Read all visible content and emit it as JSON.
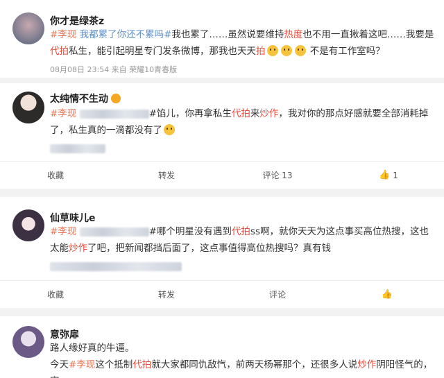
{
  "posts": [
    {
      "username": "你才是绿茶z",
      "text": {
        "tag1": "#李现",
        "tag2": " 我都累了你还不累吗#",
        "p1": "我也累了……虽然说要维持",
        "h1": "热度",
        "p2": "也不用一直揪着这吧……我要是",
        "h2": "代拍",
        "p3": "私生，能引起明星专门发条微博，那我也天天",
        "h3": "拍",
        "p4": " 不是有工作室吗？"
      },
      "meta": "08月08日 23:54  来自 荣耀10青春版"
    },
    {
      "username": "太纯情不生动",
      "text": {
        "tag1": "#李现",
        "p1": "#馅儿，你再拿私生",
        "h1": "代拍",
        "p2": "来",
        "h2": "炒作",
        "p3": "，我对你的那点好感就要全部消耗掉了，私生真的一滴都没有了"
      },
      "actions": {
        "collect": "收藏",
        "repost": "转发",
        "comment": "评论 13",
        "like": "1"
      }
    },
    {
      "username": "仙草味儿e",
      "text": {
        "tag1": "#李现",
        "p1": "#哪个明星没有遇到",
        "h1": "代拍",
        "p2": "ss啊，就你天天为这点事买高位热搜，这也太能",
        "h2": "炒作",
        "p3": "了吧，把新闻都挡后面了，这点事值得高位热搜吗？真有钱"
      },
      "actions": {
        "collect": "收藏",
        "repost": "转发",
        "comment": "评论",
        "like": ""
      }
    },
    {
      "username": "意弥扉",
      "text": {
        "line1": "路人缘好真的牛逼。",
        "p1": "今天",
        "tag1": "#李现",
        "p2": "这个抵制",
        "h1": "代拍",
        "p3": "就大家都同仇敌忾，前两天杨幂那个，还很多人说",
        "h2": "炒作",
        "p4": "阴阳怪气的，害，"
      }
    }
  ],
  "colors": {
    "tag": "#eb7350",
    "highlight": "#e74c3c",
    "muted": "#999999"
  },
  "icons": {
    "like": "thumbs-up-icon",
    "emoji": "smile-emoji"
  }
}
